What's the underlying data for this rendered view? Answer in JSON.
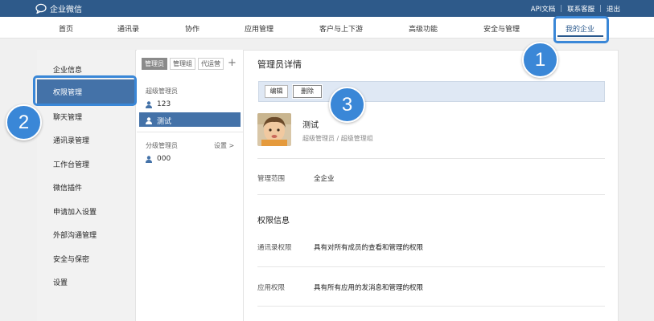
{
  "topbar": {
    "app_name": "企业微信",
    "links": [
      "API文档",
      "联系客服",
      "退出"
    ]
  },
  "nav": {
    "items": [
      "首页",
      "通讯录",
      "协作",
      "应用管理",
      "客户与上下游",
      "高级功能",
      "安全与管理",
      "我的企业"
    ],
    "active": "我的企业"
  },
  "sidebar": {
    "items": [
      "企业信息",
      "权限管理",
      "聊天管理",
      "通讯录管理",
      "工作台管理",
      "微信插件",
      "申请加入设置",
      "外部沟通管理",
      "安全与保密",
      "设置"
    ],
    "active": "权限管理"
  },
  "middle": {
    "tabs": [
      "管理员",
      "管理组",
      "代运营"
    ],
    "active_tab": "管理员",
    "add_label": "+",
    "super_admin_label": "超级管理员",
    "super_admins": [
      "123",
      "测试"
    ],
    "selected": "测试",
    "branch_admin_label": "分级管理员",
    "settings_label": "设置 >",
    "branch_admins": [
      "000"
    ]
  },
  "detail": {
    "title": "管理员详情",
    "edit_button": "编辑",
    "delete_button": "删除",
    "name": "测试",
    "role": "超级管理员 / 超级管理组",
    "scope_key": "管理范围",
    "scope_value": "全企业",
    "permission_section": "权限信息",
    "permissions": [
      {
        "key": "通讯录权限",
        "value": "具有对所有成员的查看和管理的权限"
      },
      {
        "key": "应用权限",
        "value": "具有所有应用的发消息和管理的权限"
      }
    ]
  },
  "annotations": {
    "callouts": [
      "1",
      "2",
      "3"
    ],
    "highlight_color": "#3a87d7"
  }
}
